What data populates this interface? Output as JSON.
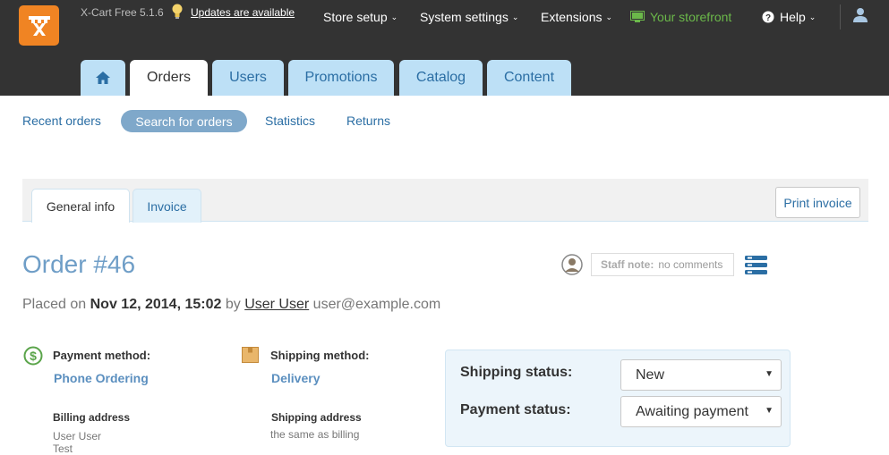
{
  "header": {
    "brand": "X-Cart Free 5.1.6",
    "updates_link": "Updates are available",
    "nav": [
      {
        "label": "Store setup"
      },
      {
        "label": "System settings"
      },
      {
        "label": "Extensions"
      }
    ],
    "storefront": "Your storefront",
    "help": "Help",
    "icons": [
      "logo-icon",
      "bulb-icon",
      "monitor-icon",
      "help-icon",
      "user-icon",
      "home-icon"
    ]
  },
  "main_tabs": [
    "Orders",
    "Users",
    "Promotions",
    "Catalog",
    "Content"
  ],
  "subnav": {
    "recent": "Recent orders",
    "search": "Search for orders",
    "statistics": "Statistics",
    "returns": "Returns"
  },
  "panel_tabs": {
    "general": "General info",
    "invoice": "Invoice",
    "print": "Print invoice"
  },
  "order": {
    "title": "Order #46",
    "placed_prefix": "Placed on",
    "placed_date": "Nov 12, 2014, 15:02",
    "by": "by",
    "user_name": "User User",
    "user_email": "user@example.com"
  },
  "staff_note": {
    "label": "Staff note:",
    "value": "no comments"
  },
  "payment": {
    "label": "Payment method:",
    "value": "Phone Ordering",
    "billing_head": "Billing address",
    "billing_lines": [
      "User User",
      "Test"
    ]
  },
  "shipping": {
    "label": "Shipping method:",
    "value": "Delivery",
    "address_head": "Shipping address",
    "address_line": "the same as billing"
  },
  "status": {
    "shipping_label": "Shipping status:",
    "shipping_value": "New",
    "payment_label": "Payment status:",
    "payment_value": "Awaiting payment"
  },
  "colors": {
    "topbar": "#333333",
    "tab_bg": "#bde0f6",
    "accent_blue": "#2b6ea4",
    "logo_orange": "#f08423",
    "storefront_green": "#6bb84a"
  }
}
